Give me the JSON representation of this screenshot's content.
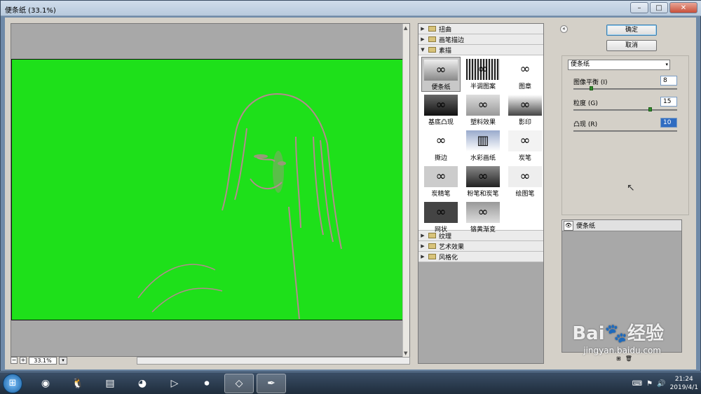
{
  "window": {
    "title": "便条纸 (33.1%)",
    "minimize": "–",
    "maximize": "□",
    "close": "✕"
  },
  "preview": {
    "zoom_value": "33.1%",
    "zoom_minus": "−",
    "zoom_plus": "+",
    "zoom_dropdown": "▾"
  },
  "gallery": {
    "categories_top": [
      {
        "label": "扭曲",
        "arrow": "▶"
      },
      {
        "label": "画笔描边",
        "arrow": "▶"
      },
      {
        "label": "素描",
        "arrow": "▼"
      }
    ],
    "thumbs": [
      {
        "label": "便条纸",
        "icon": "∞"
      },
      {
        "label": "半调图案",
        "icon": "∞"
      },
      {
        "label": "图章",
        "icon": "∞"
      },
      {
        "label": "基底凸现",
        "icon": "∞"
      },
      {
        "label": "塑料效果",
        "icon": "∞"
      },
      {
        "label": "影印",
        "icon": "∞"
      },
      {
        "label": "撕边",
        "icon": "∞"
      },
      {
        "label": "水彩画纸",
        "icon": "▥"
      },
      {
        "label": "炭笔",
        "icon": "∞"
      },
      {
        "label": "炭精笔",
        "icon": "∞"
      },
      {
        "label": "粉笔和炭笔",
        "icon": "∞"
      },
      {
        "label": "绘图笔",
        "icon": "∞"
      },
      {
        "label": "网状",
        "icon": "∞"
      },
      {
        "label": "铬黄渐变",
        "icon": "∞"
      }
    ],
    "categories_bottom": [
      {
        "label": "纹理",
        "arrow": "▶"
      },
      {
        "label": "艺术效果",
        "arrow": "▶"
      },
      {
        "label": "风格化",
        "arrow": "▶"
      }
    ]
  },
  "controls": {
    "collapse": "«",
    "ok": "确定",
    "cancel": "取消",
    "filter_select": "便条纸",
    "filter_arrow": "▾",
    "params": [
      {
        "label": "图像平衡 (I)",
        "value": "8",
        "max": 50
      },
      {
        "label": "粒度 (G)",
        "value": "15",
        "max": 20
      },
      {
        "label": "凸现 (R)",
        "value": "10",
        "max": 25
      }
    ],
    "layer_label": "便条纸",
    "layer_eye": "👁",
    "new_layer": "⊞",
    "delete_layer": "🗑"
  },
  "watermark": {
    "brand": "Bai🐾经验",
    "url": "jingyan.baidu.com"
  },
  "taskbar": {
    "start": "⊞",
    "apps": [
      {
        "name": "browser-360",
        "glyph": "◉"
      },
      {
        "name": "qq",
        "glyph": "🐧"
      },
      {
        "name": "file-explorer",
        "glyph": "▤"
      },
      {
        "name": "firefox",
        "glyph": "◕"
      },
      {
        "name": "media-player",
        "glyph": "▷"
      },
      {
        "name": "recorder",
        "glyph": "⏺"
      },
      {
        "name": "app-window",
        "glyph": "◇"
      },
      {
        "name": "photoshop-feather",
        "glyph": "✒"
      }
    ],
    "time": "21:24",
    "date": "2019/4/1"
  }
}
